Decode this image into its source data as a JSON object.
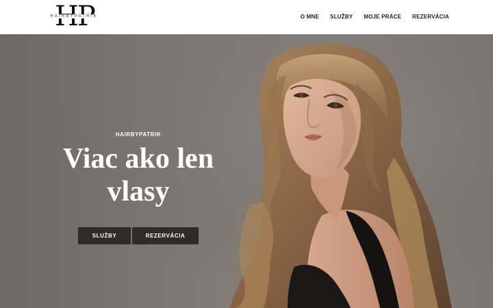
{
  "header": {
    "logo": {
      "monogram": "HP",
      "wordmark": "HAIRBYPATRIK"
    },
    "nav": [
      {
        "label": "O MNE"
      },
      {
        "label": "SLUŽBY"
      },
      {
        "label": "MOJE PRÁCE"
      },
      {
        "label": "REZERVÁCIA"
      }
    ]
  },
  "hero": {
    "kicker": "HAIRBYPATRIK",
    "headline": "Viac ako len vlasy",
    "buttons": {
      "services": "SLUŽBY",
      "booking": "REZERVÁCIA"
    },
    "image": "portrait-woman-long-wavy-hair"
  },
  "colors": {
    "header_bg": "#ffffff",
    "hero_bg": "#807a75",
    "button_bg": "#2e2c2b",
    "text_light": "#ffffff",
    "nav_text": "#222222"
  }
}
